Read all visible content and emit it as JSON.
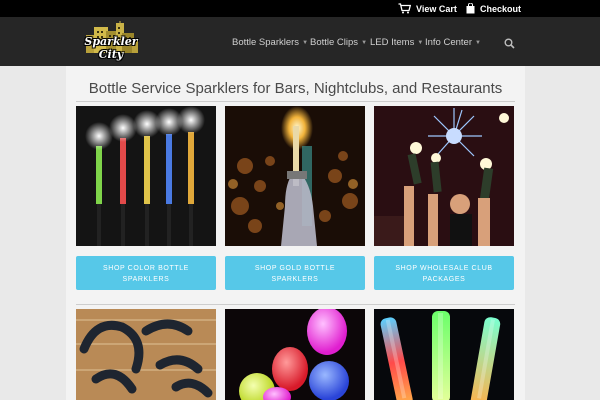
{
  "topbar": {
    "cart_label": "View Cart",
    "checkout_label": "Checkout"
  },
  "header": {
    "logo_text": "Sparkler City",
    "nav": [
      {
        "label": "Bottle Sparklers"
      },
      {
        "label": "Bottle Clips"
      },
      {
        "label": "LED Items"
      },
      {
        "label": "Info Center"
      }
    ]
  },
  "main": {
    "page_title": "Bottle Service Sparklers for Bars, Nightclubs, and Restaurants",
    "buttons": [
      {
        "line1": "SHOP COLOR BOTTLE",
        "line2": "SPARKLERS"
      },
      {
        "line1": "SHOP GOLD BOTTLE",
        "line2": "SPARKLERS"
      },
      {
        "line1": "SHOP WHOLESALE CLUB",
        "line2": "PACKAGES"
      }
    ]
  },
  "colors": {
    "accent_button": "#56c8e8",
    "topbar_bg": "#000000",
    "header_bg": "#262626"
  }
}
